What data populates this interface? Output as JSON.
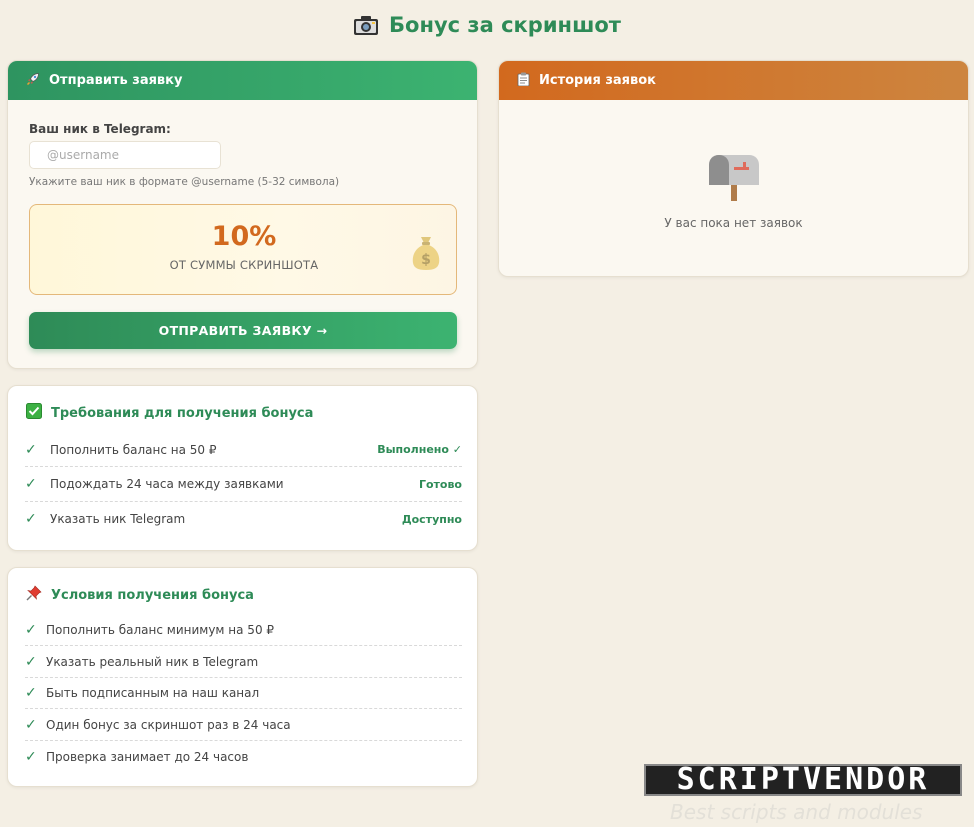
{
  "page": {
    "title": "Бонус за скриншот",
    "title_icon": "camera-icon"
  },
  "submit": {
    "header": "Отправить заявку",
    "header_icon": "rocket-icon",
    "field_label": "Ваш ник в Telegram:",
    "input_value": "",
    "input_placeholder": "@username",
    "hint": "Укажите ваш ник в формате @username (5-32 символа)",
    "bonus_percent": "10%",
    "bonus_caption": "ОТ СУММЫ СКРИНШОТА",
    "bonus_icon": "money-bag-icon",
    "button_label": "ОТПРАВИТЬ ЗАЯВКУ →"
  },
  "history": {
    "header": "История заявок",
    "header_icon": "clipboard-icon",
    "empty_icon": "mailbox-icon",
    "empty_text": "У вас пока нет заявок"
  },
  "requirements": {
    "title": "Требования для получения бонуса",
    "title_icon": "check-box-icon",
    "items": [
      {
        "label": "Пополнить баланс на 50 ₽",
        "status": "Выполнено ✓"
      },
      {
        "label": "Подождать 24 часа между заявками",
        "status": "Готово"
      },
      {
        "label": "Указать ник Telegram",
        "status": "Доступно"
      }
    ]
  },
  "conditions": {
    "title": "Условия получения бонуса",
    "title_icon": "pushpin-icon",
    "items": [
      {
        "label": "Пополнить баланс минимум на 50 ₽"
      },
      {
        "label": "Указать реальный ник в Telegram"
      },
      {
        "label": "Быть подписанным на наш канал"
      },
      {
        "label": "Один бонус за скриншот раз в 24 часа"
      },
      {
        "label": "Проверка занимает до 24 часов"
      }
    ]
  },
  "watermark": {
    "logo": "SCRIPTVENDOR",
    "tagline": "Best scripts and modules"
  },
  "colors": {
    "accent_green": "#2e8b57",
    "accent_orange": "#d2691e",
    "background": "#f4efe4"
  }
}
